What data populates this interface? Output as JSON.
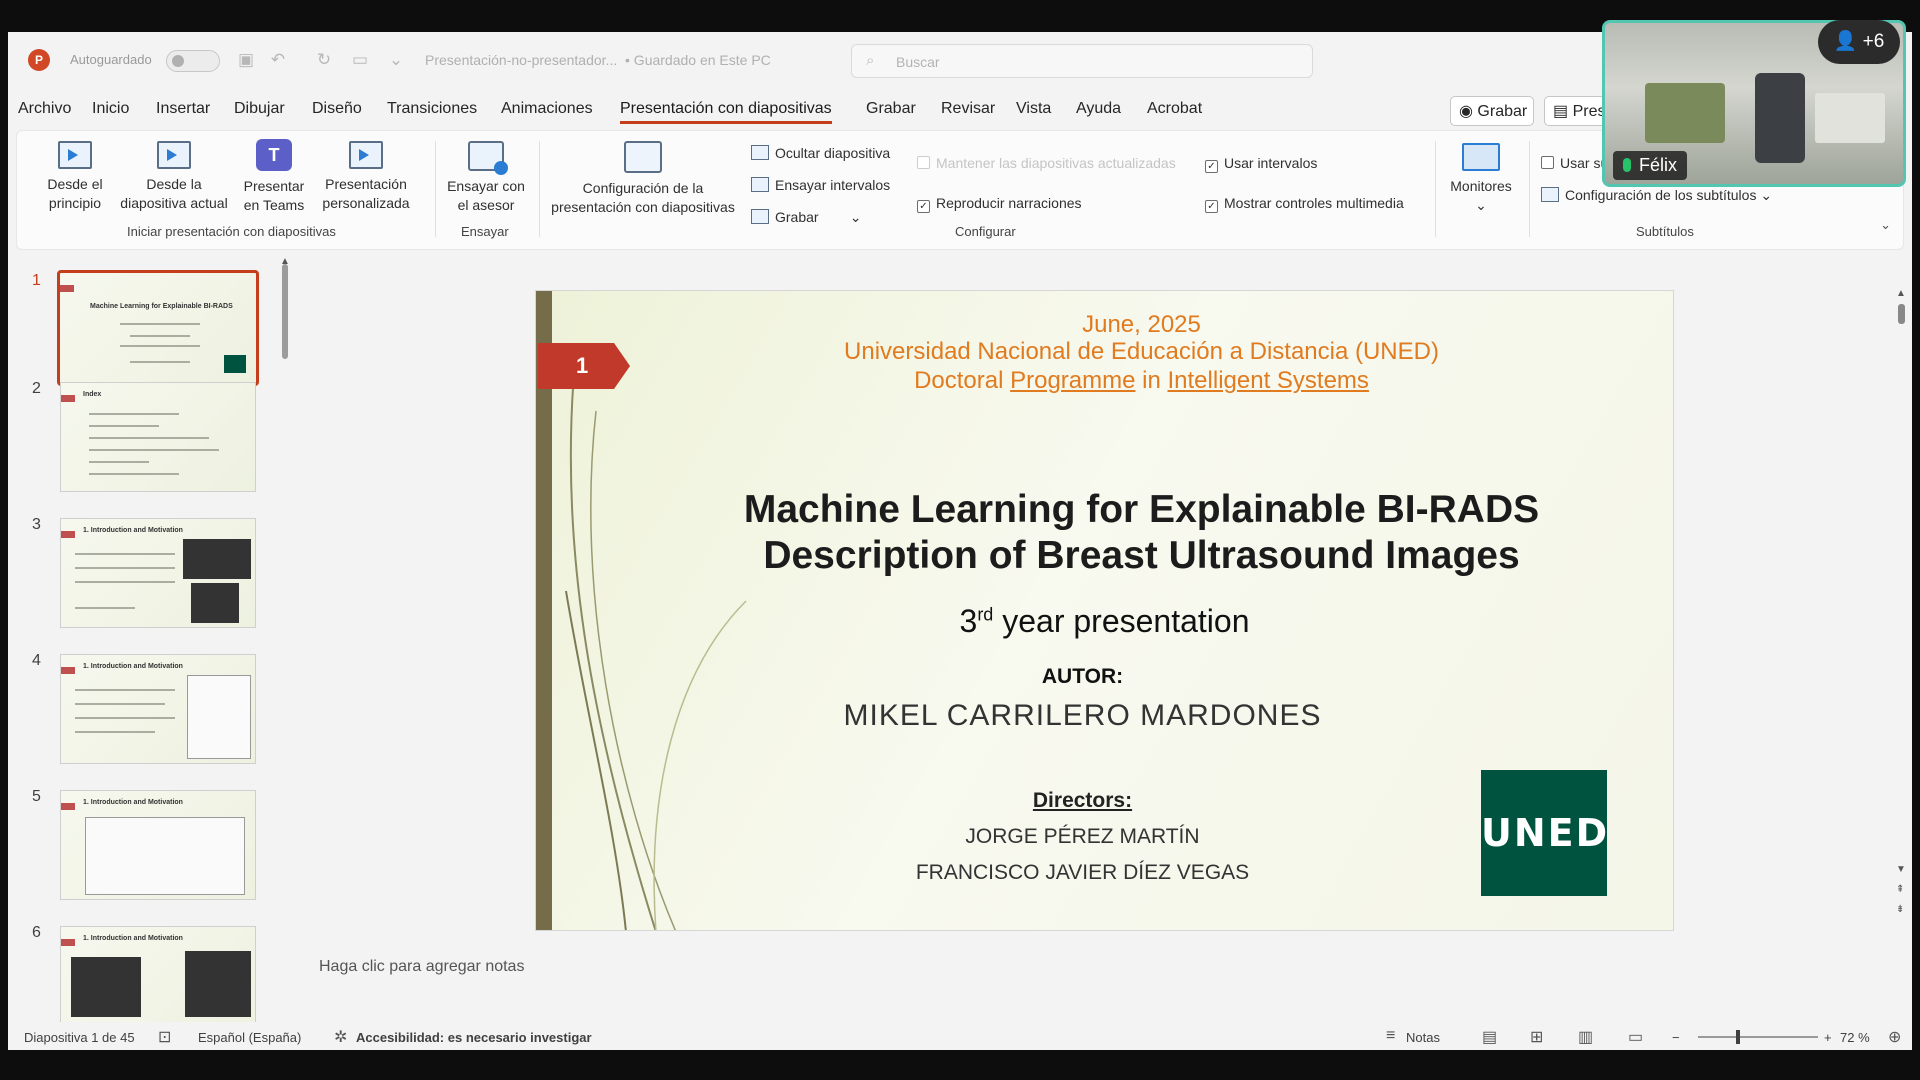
{
  "titlebar": {
    "app_icon": "P",
    "autosave_label": "Autoguardado",
    "doc_title": "Presentación-no-presentador...",
    "save_status": "• Guardado en Este PC",
    "search_placeholder": "Buscar"
  },
  "menu": {
    "items": [
      "Archivo",
      "Inicio",
      "Insertar",
      "Dibujar",
      "Diseño",
      "Transiciones",
      "Animaciones",
      "Presentación con diapositivas",
      "Grabar",
      "Revisar",
      "Vista",
      "Ayuda",
      "Acrobat"
    ],
    "active_index": 7,
    "record_button": "Grabar",
    "present_button": "Pres"
  },
  "ribbon": {
    "from_start": [
      "Desde el",
      "principio"
    ],
    "from_current": [
      "Desde la",
      "diapositiva actual"
    ],
    "present_teams": [
      "Presentar",
      "en Teams"
    ],
    "custom_show": [
      "Presentación",
      "personalizada"
    ],
    "rehearse_coach": [
      "Ensayar con",
      "el asesor"
    ],
    "setup_show": [
      "Configuración de la",
      "presentación con diapositivas"
    ],
    "hide_slide": "Ocultar diapositiva",
    "rehearse_timings": "Ensayar intervalos",
    "record": "Grabar",
    "keep_updated": "Mantener las diapositivas actualizadas",
    "play_narrations": "Reproducir narraciones",
    "use_timings": "Usar intervalos",
    "show_media_controls": "Mostrar controles multimedia",
    "monitors": "Monitores",
    "use_subtitles": "Usar su",
    "subtitle_settings": "Configuración de los subtítulos",
    "groups": {
      "start": "Iniciar presentación con diapositivas",
      "rehearse": "Ensayar",
      "setup": "Configurar",
      "subtitles": "Subtítulos"
    }
  },
  "thumbnails": [
    {
      "num": "1",
      "title": "Machine Learning for Explainable BI-RADS"
    },
    {
      "num": "2",
      "title": "Index"
    },
    {
      "num": "3",
      "title": "1. Introduction and Motivation"
    },
    {
      "num": "4",
      "title": "1. Introduction and Motivation"
    },
    {
      "num": "5",
      "title": "1. Introduction and Motivation"
    },
    {
      "num": "6",
      "title": "1. Introduction and Motivation"
    }
  ],
  "slide": {
    "number": "1",
    "date": "June, 2025",
    "university": "Universidad Nacional de Educación a Distancia (UNED)",
    "program_pre": "Doctoral ",
    "program_link1": "Programme",
    "program_mid": " in ",
    "program_link2": "Intelligent Systems",
    "title_line1": "Machine Learning for Explainable BI-RADS",
    "title_line2": "Description of Breast Ultrasound Images",
    "subtitle_num": "3",
    "subtitle_sup": "rd",
    "subtitle_rest": " year presentation",
    "author_label": "AUTOR:",
    "author": "MIKEL CARRILERO MARDONES",
    "directors_label": "Directors:",
    "director1": "JORGE PÉREZ MARTÍN",
    "director2": "FRANCISCO JAVIER DÍEZ VEGAS",
    "logo_text": "UNED"
  },
  "notes_placeholder": "Haga clic para agregar notas",
  "statusbar": {
    "slide_counter": "Diapositiva 1 de 45",
    "language": "Español (España)",
    "accessibility": "Accesibilidad: es necesario investigar",
    "notes": "Notas",
    "zoom_percent": "72 %"
  },
  "video": {
    "participant_name": "Félix",
    "participants_badge": "+6"
  }
}
